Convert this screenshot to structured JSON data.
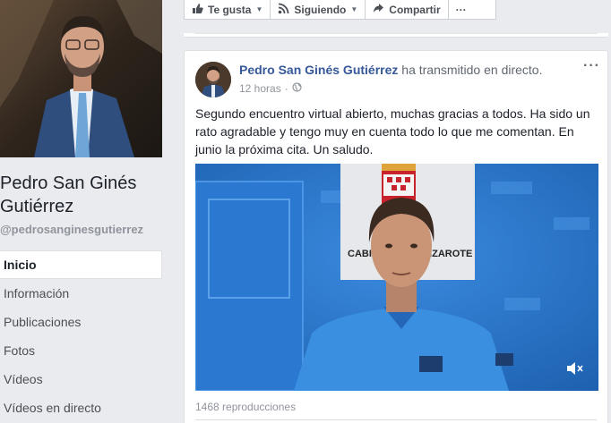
{
  "page": {
    "name": "Pedro San Ginés Gutiérrez",
    "handle": "@pedrosanginesgutierrez"
  },
  "nav": {
    "items": [
      {
        "label": "Inicio",
        "active": true
      },
      {
        "label": "Información"
      },
      {
        "label": "Publicaciones"
      },
      {
        "label": "Fotos"
      },
      {
        "label": "Vídeos"
      },
      {
        "label": "Vídeos en directo"
      }
    ]
  },
  "actions": {
    "like": "Te gusta",
    "following": "Siguiendo",
    "share": "Compartir",
    "more": "···"
  },
  "post": {
    "author": "Pedro San Ginés Gutiérrez",
    "action": "ha transmitido en directo.",
    "time": "12 horas",
    "separator": "·",
    "more": "···",
    "text": "Segundo encuentro virtual abierto, muchas gracias a todos. Ha sido un rato agradable y tengo muy en cuenta todo lo que me comentan. En junio la próxima cita. Un saludo.",
    "backdrop_text": "CABILDO DE LANZAROTE",
    "views": "1468 reproducciones"
  },
  "colors": {
    "link": "#365899",
    "background": "#e9ebee",
    "video_backdrop": "#2b74c6"
  }
}
